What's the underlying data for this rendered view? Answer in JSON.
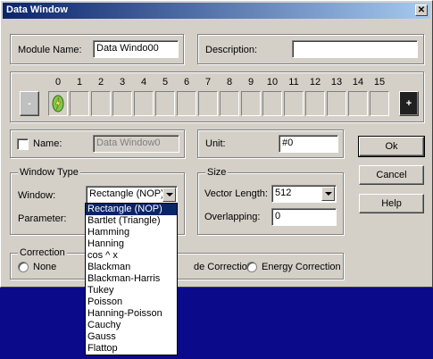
{
  "window": {
    "title": "Data Window",
    "close_glyph": "✕"
  },
  "module": {
    "name_label": "Module Name:",
    "name_value": "Data Windo00",
    "description_label": "Description:",
    "description_value": ""
  },
  "channels": {
    "numbers": [
      "0",
      "1",
      "2",
      "3",
      "4",
      "5",
      "6",
      "7",
      "8",
      "9",
      "10",
      "11",
      "12",
      "13",
      "14",
      "15"
    ],
    "remove_glyph": "-",
    "add_glyph": "+"
  },
  "name_row": {
    "label": "Name:",
    "value": "Data Window0"
  },
  "unit": {
    "label": "Unit:",
    "value": "#0"
  },
  "buttons": {
    "ok": "Ok",
    "cancel": "Cancel",
    "help": "Help"
  },
  "window_type": {
    "legend": "Window Type",
    "window_label": "Window:",
    "window_value": "Rectangle (NOP)",
    "parameter_label": "Parameter:"
  },
  "size": {
    "legend": "Size",
    "vector_length_label": "Vector Length:",
    "vector_length_value": "512",
    "overlapping_label": "Overlapping:",
    "overlapping_value": "0"
  },
  "correction": {
    "legend": "Correction",
    "none": "None",
    "amplitude_partial": "de Correction",
    "energy": "Energy Correction"
  },
  "dropdown": {
    "items": [
      "Rectangle (NOP)",
      "Bartlet (Triangle)",
      "Hamming",
      "Hanning",
      "cos ^ x",
      "Blackman",
      "Blackman-Harris",
      "Tukey",
      "Poisson",
      "Hanning-Poisson",
      "Cauchy",
      "Gauss",
      "Flattop"
    ],
    "selected_index": 0
  },
  "colors": {
    "titlebar": "#0a246a",
    "selection": "#0a246a",
    "background": "#0a0a8a",
    "face": "#d4d0c8"
  }
}
